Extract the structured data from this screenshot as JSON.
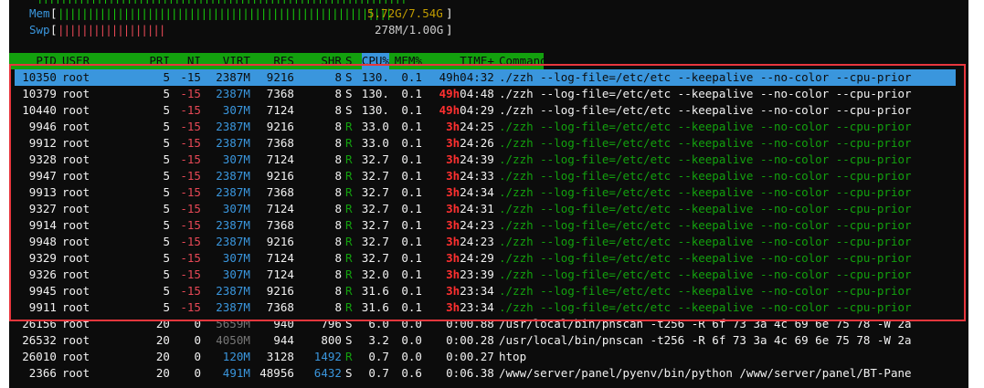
{
  "meters": {
    "mem": {
      "label": "Mem",
      "value": "5.72G/7.54G",
      "bars": "||||||||||||||||||||||||||||||||||||||||||||||||||||||||"
    },
    "swp": {
      "label": "Swp",
      "value": "278M/1.00G",
      "bars": "||||||||||||||||||"
    }
  },
  "columns": [
    "PID",
    "USER",
    "PRI",
    "NI",
    "VIRT",
    "RES",
    "SHR",
    "S",
    "CPU%",
    "MEM%",
    "TIME+",
    "Command"
  ],
  "sorted_column": "CPU%",
  "colors": {
    "header_bg": "#13a10e",
    "selection_bg": "#3a96dd",
    "highlight_box": "#e8363d"
  },
  "rows": [
    {
      "pid": "10350",
      "user": "root",
      "pri": "5",
      "ni": "-15",
      "virt": "2387M",
      "res": "9216",
      "shr": "8",
      "s": "S",
      "cpu": "130.",
      "mem": "0.1",
      "time_h": "49h",
      "time_r": "04:32",
      "cmd": "./zzh --log-file=/etc/etc --keepalive --no-color --cpu-prior",
      "selected": true
    },
    {
      "pid": "10379",
      "user": "root",
      "pri": "5",
      "ni": "-15",
      "virt": "2387M",
      "res": "7368",
      "shr": "8",
      "s": "S",
      "cpu": "130.",
      "mem": "0.1",
      "time_h": "49h",
      "time_r": "04:48",
      "cmd": "./zzh --log-file=/etc/etc --keepalive --no-color --cpu-prior"
    },
    {
      "pid": "10440",
      "user": "root",
      "pri": "5",
      "ni": "-15",
      "virt": "307M",
      "res": "7124",
      "shr": "8",
      "s": "S",
      "cpu": "130.",
      "mem": "0.1",
      "time_h": "49h",
      "time_r": "04:29",
      "cmd": "./zzh --log-file=/etc/etc --keepalive --no-color --cpu-prior"
    },
    {
      "pid": "9946",
      "user": "root",
      "pri": "5",
      "ni": "-15",
      "virt": "2387M",
      "res": "9216",
      "shr": "8",
      "s": "R",
      "cpu": "33.0",
      "mem": "0.1",
      "time_h": "3h",
      "time_r": "24:25",
      "cmd": "./zzh --log-file=/etc/etc --keepalive --no-color --cpu-prior"
    },
    {
      "pid": "9912",
      "user": "root",
      "pri": "5",
      "ni": "-15",
      "virt": "2387M",
      "res": "7368",
      "shr": "8",
      "s": "R",
      "cpu": "33.0",
      "mem": "0.1",
      "time_h": "3h",
      "time_r": "24:26",
      "cmd": "./zzh --log-file=/etc/etc --keepalive --no-color --cpu-prior"
    },
    {
      "pid": "9328",
      "user": "root",
      "pri": "5",
      "ni": "-15",
      "virt": "307M",
      "res": "7124",
      "shr": "8",
      "s": "R",
      "cpu": "32.7",
      "mem": "0.1",
      "time_h": "3h",
      "time_r": "24:39",
      "cmd": "./zzh --log-file=/etc/etc --keepalive --no-color --cpu-prior"
    },
    {
      "pid": "9947",
      "user": "root",
      "pri": "5",
      "ni": "-15",
      "virt": "2387M",
      "res": "9216",
      "shr": "8",
      "s": "R",
      "cpu": "32.7",
      "mem": "0.1",
      "time_h": "3h",
      "time_r": "24:33",
      "cmd": "./zzh --log-file=/etc/etc --keepalive --no-color --cpu-prior"
    },
    {
      "pid": "9913",
      "user": "root",
      "pri": "5",
      "ni": "-15",
      "virt": "2387M",
      "res": "7368",
      "shr": "8",
      "s": "R",
      "cpu": "32.7",
      "mem": "0.1",
      "time_h": "3h",
      "time_r": "24:34",
      "cmd": "./zzh --log-file=/etc/etc --keepalive --no-color --cpu-prior"
    },
    {
      "pid": "9327",
      "user": "root",
      "pri": "5",
      "ni": "-15",
      "virt": "307M",
      "res": "7124",
      "shr": "8",
      "s": "R",
      "cpu": "32.7",
      "mem": "0.1",
      "time_h": "3h",
      "time_r": "24:31",
      "cmd": "./zzh --log-file=/etc/etc --keepalive --no-color --cpu-prior"
    },
    {
      "pid": "9914",
      "user": "root",
      "pri": "5",
      "ni": "-15",
      "virt": "2387M",
      "res": "7368",
      "shr": "8",
      "s": "R",
      "cpu": "32.7",
      "mem": "0.1",
      "time_h": "3h",
      "time_r": "24:23",
      "cmd": "./zzh --log-file=/etc/etc --keepalive --no-color --cpu-prior"
    },
    {
      "pid": "9948",
      "user": "root",
      "pri": "5",
      "ni": "-15",
      "virt": "2387M",
      "res": "9216",
      "shr": "8",
      "s": "R",
      "cpu": "32.7",
      "mem": "0.1",
      "time_h": "3h",
      "time_r": "24:23",
      "cmd": "./zzh --log-file=/etc/etc --keepalive --no-color --cpu-prior"
    },
    {
      "pid": "9329",
      "user": "root",
      "pri": "5",
      "ni": "-15",
      "virt": "307M",
      "res": "7124",
      "shr": "8",
      "s": "R",
      "cpu": "32.7",
      "mem": "0.1",
      "time_h": "3h",
      "time_r": "24:29",
      "cmd": "./zzh --log-file=/etc/etc --keepalive --no-color --cpu-prior"
    },
    {
      "pid": "9326",
      "user": "root",
      "pri": "5",
      "ni": "-15",
      "virt": "307M",
      "res": "7124",
      "shr": "8",
      "s": "R",
      "cpu": "32.0",
      "mem": "0.1",
      "time_h": "3h",
      "time_r": "23:39",
      "cmd": "./zzh --log-file=/etc/etc --keepalive --no-color --cpu-prior"
    },
    {
      "pid": "9945",
      "user": "root",
      "pri": "5",
      "ni": "-15",
      "virt": "2387M",
      "res": "9216",
      "shr": "8",
      "s": "R",
      "cpu": "31.6",
      "mem": "0.1",
      "time_h": "3h",
      "time_r": "23:34",
      "cmd": "./zzh --log-file=/etc/etc --keepalive --no-color --cpu-prior"
    },
    {
      "pid": "9911",
      "user": "root",
      "pri": "5",
      "ni": "-15",
      "virt": "2387M",
      "res": "7368",
      "shr": "8",
      "s": "R",
      "cpu": "31.6",
      "mem": "0.1",
      "time_h": "3h",
      "time_r": "23:34",
      "cmd": "./zzh --log-file=/etc/etc --keepalive --no-color --cpu-prior"
    },
    {
      "pid": "26156",
      "user": "root",
      "pri": "20",
      "ni": "0",
      "virt": "5659M",
      "res": "940",
      "shr": "796",
      "s": "S",
      "cpu": "6.0",
      "mem": "0.0",
      "time_h": "",
      "time_r": "0:00.88",
      "cmd": "/usr/local/bin/pnscan -t256 -R 6f 73 3a 4c 69 6e 75 78 -W 2a",
      "system": true
    },
    {
      "pid": "26532",
      "user": "root",
      "pri": "20",
      "ni": "0",
      "virt": "4050M",
      "res": "944",
      "shr": "800",
      "s": "S",
      "cpu": "3.2",
      "mem": "0.0",
      "time_h": "",
      "time_r": "0:00.28",
      "cmd": "/usr/local/bin/pnscan -t256 -R 6f 73 3a 4c 69 6e 75 78 -W 2a",
      "system": true
    },
    {
      "pid": "26010",
      "user": "root",
      "pri": "20",
      "ni": "0",
      "virt": "120M",
      "res": "3128",
      "shr": "1492",
      "s": "R",
      "cpu": "0.7",
      "mem": "0.0",
      "time_h": "",
      "time_r": "0:00.27",
      "cmd": "htop",
      "system": true
    },
    {
      "pid": "2366",
      "user": "root",
      "pri": "20",
      "ni": "0",
      "virt": "491M",
      "res": "48956",
      "shr": "6432",
      "s": "S",
      "cpu": "0.7",
      "mem": "0.6",
      "time_h": "",
      "time_r": "0:06.38",
      "cmd": "/www/server/panel/pyenv/bin/python /www/server/panel/BT-Pane",
      "system": true
    }
  ]
}
